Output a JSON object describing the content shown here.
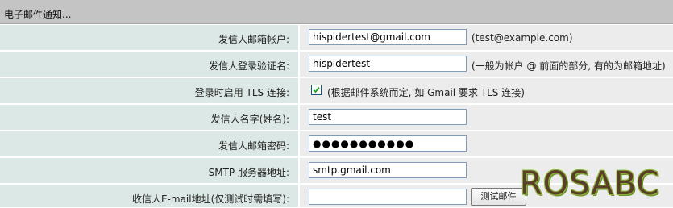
{
  "section": {
    "title": "电子邮件通知..."
  },
  "rows": [
    {
      "label": "发信人邮箱帐户:",
      "value": "hispidertest@gmail.com",
      "hint": "(test@example.com)"
    },
    {
      "label": "发信人登录验证名:",
      "value": "hispidertest",
      "hint": "(一般为帐户 @ 前面的部分, 有的为邮箱地址)"
    },
    {
      "label": "登录时启用 TLS 连接:",
      "checked": true,
      "hint": "(根据邮件系统而定, 如 Gmail 要求 TLS 连接)"
    },
    {
      "label": "发信人名字(姓名):",
      "value": "test"
    },
    {
      "label": "发信人邮箱密码:",
      "value": "●●●●●●●●●●●"
    },
    {
      "label": "SMTP 服务器地址:",
      "value": "smtp.gmail.com"
    },
    {
      "label": "收信人E-mail地址(仅测试时需填写):",
      "value": "",
      "button": "测试邮件"
    }
  ],
  "watermark": "ROSABC",
  "colors": {
    "header": "#c4c4c4",
    "label_bg": "#dce8e5",
    "value_bg": "#ececec"
  }
}
